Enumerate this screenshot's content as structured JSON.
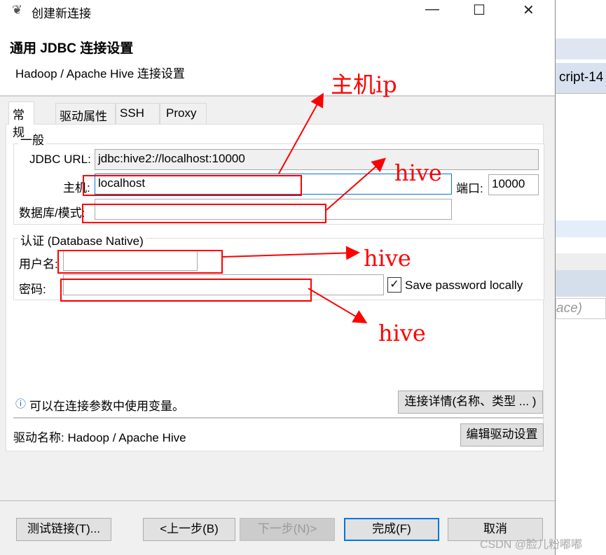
{
  "background_app": {
    "tab_fragment": "cript-14",
    "italic_fragment": "ace)"
  },
  "window": {
    "title": "创建新连接",
    "icon": "dbeaver-icon",
    "minimize": "—",
    "maximize": "☐",
    "close": "✕"
  },
  "header": {
    "title": "通用 JDBC 连接设置",
    "subtitle": "Hadoop / Apache Hive 连接设置"
  },
  "tabs": [
    {
      "label": "常规",
      "selected": true
    },
    {
      "label": "驱动属性"
    },
    {
      "label": "SSH"
    },
    {
      "label": "Proxy"
    }
  ],
  "general": {
    "group_label": "一般",
    "jdbc_url_label": "JDBC URL:",
    "jdbc_url_value": "jdbc:hive2://localhost:10000",
    "host_label": "主机:",
    "host_value": "localhost",
    "port_label": "端口:",
    "port_value": "10000",
    "database_label": "数据库/模式:",
    "database_value": ""
  },
  "auth": {
    "group_label": "认证 (Database Native)",
    "username_label": "用户名:",
    "username_value": "",
    "password_label": "密码:",
    "password_value": "",
    "save_password_label": "Save password locally",
    "save_password_checked": true
  },
  "info": {
    "icon": "info-icon",
    "text": "可以在连接参数中使用变量。",
    "details_button": "连接详情(名称、类型 ... )"
  },
  "driver": {
    "text": "驱动名称: Hadoop / Apache Hive",
    "edit_button": "编辑驱动设置"
  },
  "footer": {
    "test": "测试链接(T)...",
    "back": "<上一步(B)",
    "next": "下一步(N)>",
    "finish": "完成(F)",
    "cancel": "取消"
  },
  "annotations": {
    "host_ip": "主机ip",
    "database": "hive",
    "username": "hive",
    "password": "hive",
    "color": "#ff0000"
  },
  "watermark": "CSDN @脸儿粉嘟嘟"
}
